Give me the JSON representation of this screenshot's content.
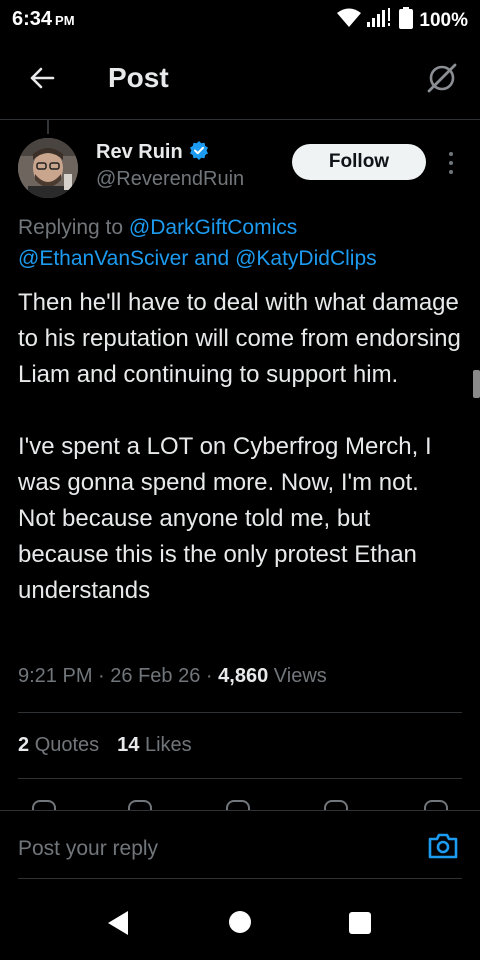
{
  "status_bar": {
    "time": "6:34",
    "ampm": "PM",
    "battery_pct": "100%",
    "icons": [
      "wifi-icon",
      "signal-icon",
      "battery-icon"
    ]
  },
  "header": {
    "title": "Post",
    "back_icon": "arrow-left-icon",
    "grok_icon": "grok-icon"
  },
  "post": {
    "author": {
      "display_name": "Rev Ruin",
      "handle": "@ReverendRuin",
      "verified": true,
      "verified_color": "#1d9bf0"
    },
    "follow_label": "Follow",
    "replying_prefix": "Replying to",
    "replying_to": [
      "@DarkGiftComics",
      "@EthanVanSciver",
      "@KatyDidClips"
    ],
    "replying_conjunction": "and",
    "text": "Then he'll have to deal with what damage to his reputation will come from endorsing Liam and continuing to support him.\n\nI've spent a LOT on Cyberfrog Merch, I was gonna spend more. Now, I'm not.  Not because anyone told me, but because this is the only protest Ethan understands",
    "time": "9:21 PM",
    "date": "26 Feb 26",
    "separator": "·",
    "views_count": "4,860",
    "views_label": "Views",
    "quotes_count": "2",
    "quotes_label": "Quotes",
    "likes_count": "14",
    "likes_label": "Likes"
  },
  "reply": {
    "placeholder": "Post your reply",
    "camera_icon": "camera-icon"
  },
  "colors": {
    "background": "#000000",
    "text": "#e7e9ea",
    "muted": "#71767b",
    "accent": "#1d9bf0",
    "divider": "#2f3336"
  }
}
